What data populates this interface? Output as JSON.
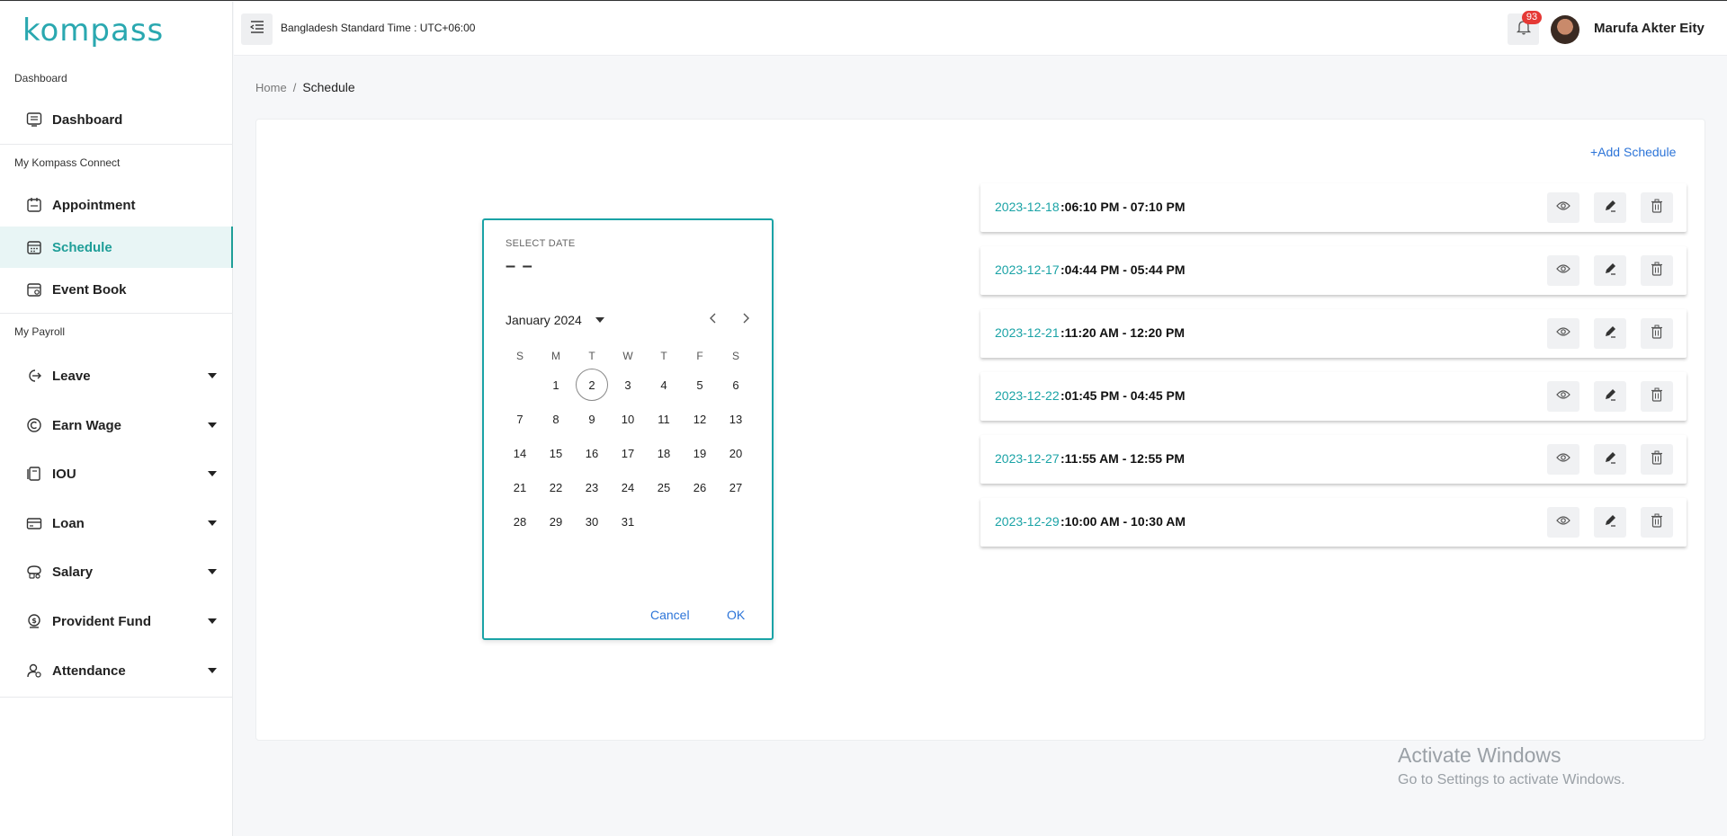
{
  "app": {
    "logo": "kompass"
  },
  "header": {
    "timezone": "Bangladesh Standard Time : UTC+06:00",
    "notification_count": "93",
    "user_name": "Marufa Akter Eity"
  },
  "sidebar": {
    "sections": [
      {
        "label": "Dashboard"
      },
      {
        "label": "My Kompass Connect"
      },
      {
        "label": "My Payroll"
      }
    ],
    "items": [
      {
        "label": "Dashboard",
        "icon": "dashboard-icon"
      },
      {
        "label": "Appointment",
        "icon": "appointment-icon"
      },
      {
        "label": "Schedule",
        "icon": "calendar-icon",
        "active": true
      },
      {
        "label": "Event Book",
        "icon": "event-book-icon"
      },
      {
        "label": "Leave",
        "icon": "leave-icon",
        "expandable": true
      },
      {
        "label": "Earn Wage",
        "icon": "earn-wage-icon",
        "expandable": true
      },
      {
        "label": "IOU",
        "icon": "iou-icon",
        "expandable": true
      },
      {
        "label": "Loan",
        "icon": "loan-icon",
        "expandable": true
      },
      {
        "label": "Salary",
        "icon": "salary-icon",
        "expandable": true
      },
      {
        "label": "Provident Fund",
        "icon": "provident-fund-icon",
        "expandable": true
      },
      {
        "label": "Attendance",
        "icon": "attendance-icon",
        "expandable": true
      }
    ]
  },
  "breadcrumb": {
    "home": "Home",
    "separator": "/",
    "current": "Schedule"
  },
  "main": {
    "add_schedule_label": "+Add Schedule"
  },
  "date_picker": {
    "label": "SELECT DATE",
    "value": "– –",
    "month_label": "January 2024",
    "weekdays": [
      "S",
      "M",
      "T",
      "W",
      "T",
      "F",
      "S"
    ],
    "weeks": [
      [
        "",
        "1",
        "2",
        "3",
        "4",
        "5",
        "6"
      ],
      [
        "7",
        "8",
        "9",
        "10",
        "11",
        "12",
        "13"
      ],
      [
        "14",
        "15",
        "16",
        "17",
        "18",
        "19",
        "20"
      ],
      [
        "21",
        "22",
        "23",
        "24",
        "25",
        "26",
        "27"
      ],
      [
        "28",
        "29",
        "30",
        "31",
        "",
        "",
        ""
      ]
    ],
    "today": "2",
    "cancel_label": "Cancel",
    "ok_label": "OK"
  },
  "schedules": [
    {
      "date": "2023-12-18",
      "time": ":06:10 PM - 07:10 PM"
    },
    {
      "date": "2023-12-17",
      "time": ":04:44 PM - 05:44 PM"
    },
    {
      "date": "2023-12-21",
      "time": ":11:20 AM - 12:20 PM"
    },
    {
      "date": "2023-12-22",
      "time": ":01:45 PM - 04:45 PM"
    },
    {
      "date": "2023-12-27",
      "time": ":11:55 AM - 12:55 PM"
    },
    {
      "date": "2023-12-29",
      "time": ":10:00 AM - 10:30 AM"
    }
  ],
  "watermark": {
    "title": "Activate Windows",
    "subtitle": "Go to Settings to activate Windows."
  },
  "colors": {
    "accent": "#1aa3a6",
    "link": "#2c74d8",
    "badge": "#e53935"
  }
}
